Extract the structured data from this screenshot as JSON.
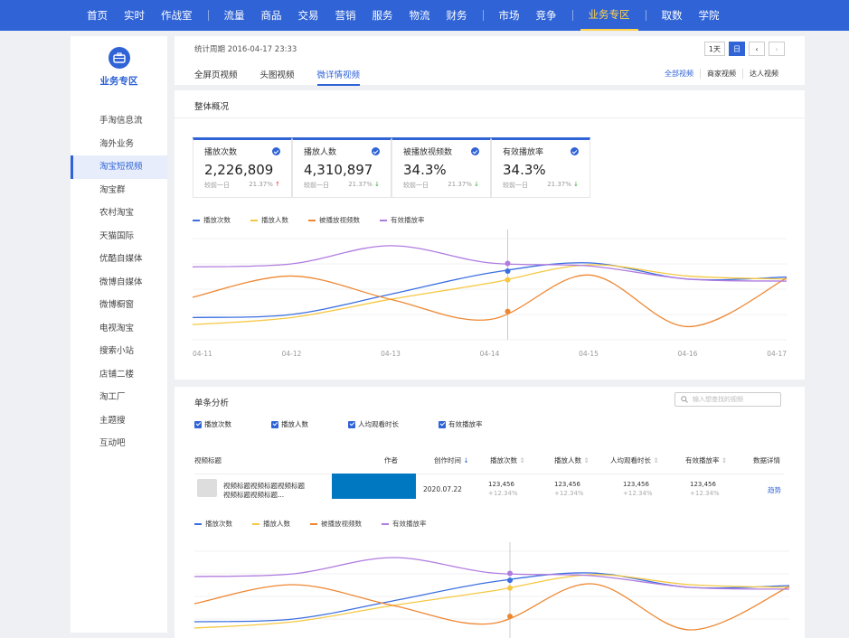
{
  "nav": {
    "groups": [
      [
        "首页",
        "实时",
        "作战室"
      ],
      [
        "流量",
        "商品",
        "交易",
        "营销",
        "服务",
        "物流",
        "财务"
      ],
      [
        "市场",
        "竞争"
      ],
      [
        "业务专区"
      ],
      [
        "取数",
        "学院"
      ]
    ],
    "active": "业务专区"
  },
  "sidebar": {
    "title": "业务专区",
    "items": [
      "手淘信息流",
      "海外业务",
      "淘宝短视频",
      "淘宝群",
      "农村淘宝",
      "天猫国际",
      "优酷自媒体",
      "微博自媒体",
      "微博橱窗",
      "电视淘宝",
      "搜索小站",
      "店铺二楼",
      "淘工厂",
      "主题搜",
      "互动吧"
    ],
    "active_index": 2
  },
  "header": {
    "period": "统计周期 2016-04-17 23:33",
    "tabs": [
      "全屏页视频",
      "头图视频",
      "微详情视频"
    ],
    "active_tab": 2,
    "ctrl_day": "1天",
    "ctrl_d": "日",
    "filters": [
      "全部视频",
      "商家视频",
      "达人视频"
    ]
  },
  "overview": {
    "title": "整体概况",
    "cards": [
      {
        "label": "播放次数",
        "value": "2,226,809",
        "compare": "较前一日",
        "pct": "21.37%",
        "dir": "up"
      },
      {
        "label": "播放人数",
        "value": "4,310,897",
        "compare": "较前一日",
        "pct": "21.37%",
        "dir": "down"
      },
      {
        "label": "被播放视频数",
        "value": "34.3%",
        "compare": "较前一日",
        "pct": "21.37%",
        "dir": "down"
      },
      {
        "label": "有效播放率",
        "value": "34.3%",
        "compare": "较前一日",
        "pct": "21.37%",
        "dir": "down"
      }
    ]
  },
  "legend": [
    "播放次数",
    "播放人数",
    "被播放视频数",
    "有效播放率"
  ],
  "colors": {
    "blue": "#3b6fe0",
    "yellow": "#f5c842",
    "orange": "#ee8732",
    "purple": "#b07be0",
    "accent": "#2f63d6"
  },
  "chart_data": {
    "type": "line",
    "x": [
      "04-11",
      "04-12",
      "04-13",
      "04-14",
      "04-15",
      "04-16",
      "04-17"
    ],
    "series": [
      {
        "name": "播放次数",
        "color": "#3b6fe0",
        "values": [
          22,
          25,
          45,
          66,
          76,
          60,
          62
        ]
      },
      {
        "name": "播放人数",
        "color": "#f5c842",
        "values": [
          15,
          22,
          40,
          56,
          74,
          63,
          60
        ]
      },
      {
        "name": "被播放视频数",
        "color": "#ee8732",
        "values": [
          42,
          63,
          40,
          20,
          64,
          13,
          61
        ]
      },
      {
        "name": "有效播放率",
        "color": "#b07be0",
        "values": [
          72,
          75,
          93,
          76,
          73,
          60,
          58
        ]
      }
    ],
    "ylim": [
      0,
      100
    ]
  },
  "single": {
    "title": "单条分析",
    "search_placeholder": "输入想查找的视频",
    "checks": [
      "播放次数",
      "播放人数",
      "人均观看时长",
      "有效播放率"
    ],
    "columns": [
      "视频标题",
      "作者",
      "创作时间",
      "播放次数",
      "播放人数",
      "人均观看时长",
      "有效播放率",
      "数据详情"
    ],
    "row": {
      "title_line1": "视频标题视频标题视频标题",
      "title_line2": "视频标题视频标题...",
      "date": "2020.07.22",
      "v1": "123,456",
      "p1": "+12.34%",
      "v2": "123,456",
      "p2": "+12.34%",
      "v3": "123,456",
      "p3": "+12.34%",
      "v4": "123,456",
      "p4": "+12.34%",
      "detail": "趋势"
    }
  }
}
